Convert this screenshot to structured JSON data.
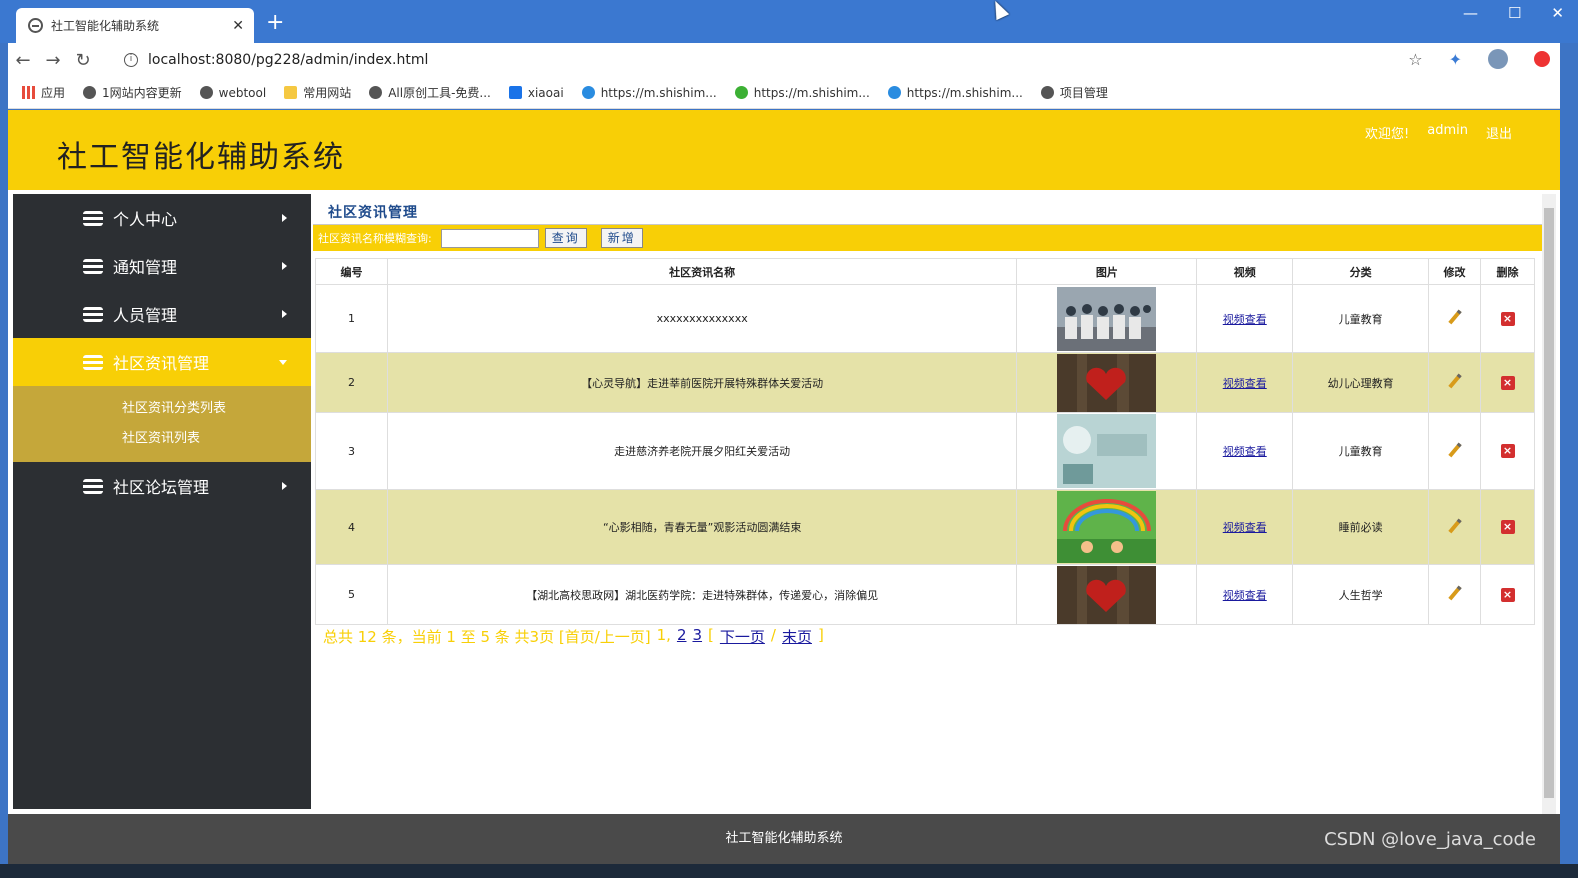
{
  "browser": {
    "tab_title": "社工智能化辅助系统",
    "url": "localhost:8080/pg228/admin/index.html",
    "bookmarks": [
      "应用",
      "1网站内容更新",
      "webtool",
      "常用网站",
      "All原创工具-免费...",
      "xiaoai",
      "https://m.shishim...",
      "https://m.shishim...",
      "https://m.shishim...",
      "项目管理"
    ]
  },
  "header": {
    "title": "社工智能化辅助系统",
    "welcome": "欢迎您!",
    "user": "admin",
    "logout": "退出"
  },
  "sidebar": {
    "items": [
      {
        "label": "个人中心"
      },
      {
        "label": "通知管理"
      },
      {
        "label": "人员管理"
      },
      {
        "label": "社区资讯管理"
      },
      {
        "label": "社区论坛管理"
      }
    ],
    "submenu": [
      "社区资讯分类列表",
      "社区资讯列表"
    ]
  },
  "content": {
    "title": "社区资讯管理",
    "search_label": "社区资讯名称模糊查询:",
    "search_value": "",
    "query_button": "查询",
    "add_button": "新增"
  },
  "table": {
    "headers": [
      "编号",
      "社区资讯名称",
      "图片",
      "视频",
      "分类",
      "修改",
      "删除"
    ],
    "rows": [
      {
        "id": "1",
        "name": "xxxxxxxxxxxxxx",
        "video": "视频查看",
        "category": "儿童教育",
        "image": "group-photo"
      },
      {
        "id": "2",
        "name": "【心灵导航】走进莘前医院开展特殊群体关爱活动",
        "video": "视频查看",
        "category": "幼儿心理教育",
        "image": "heart-photo"
      },
      {
        "id": "3",
        "name": "走进慈济养老院开展夕阳红关爱活动",
        "video": "视频查看",
        "category": "儿童教育",
        "image": "mental-health-photo"
      },
      {
        "id": "4",
        "name": "“心影相随，青春无量”观影活动圆满结束",
        "video": "视频查看",
        "category": "睡前必读",
        "image": "rainbow-photo"
      },
      {
        "id": "5",
        "name": "【湖北高校思政网】湖北医药学院：走进特殊群体，传递爱心，消除偏见",
        "video": "视频查看",
        "category": "人生哲学",
        "image": "heart-photo"
      }
    ]
  },
  "pager": {
    "summary": "总共 12 条，当前 1 至 5 条 共3页 [首页/上一页]",
    "current": "1,",
    "page2": "2",
    "page3": "3",
    "next": "下一页",
    "last": "末页"
  },
  "footer": {
    "text": "社工智能化辅助系统"
  },
  "watermark": "CSDN @love_java_code",
  "colors": {
    "accent": "#f8cf06",
    "sidebar": "#2c2f33",
    "submenu": "#c5a73a",
    "row_alt": "#e5e2a8"
  }
}
